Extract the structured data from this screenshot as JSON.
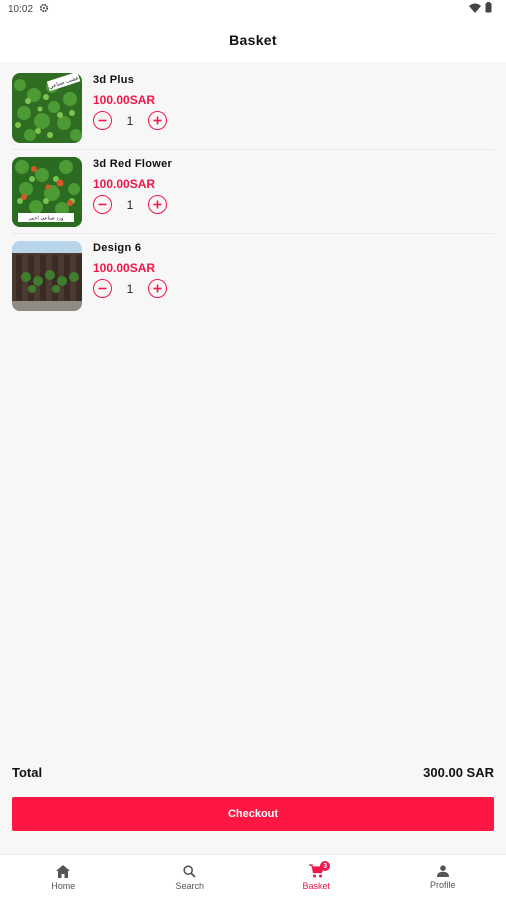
{
  "status_bar": {
    "time": "10:02",
    "icons": [
      "settings-icon",
      "wifi-icon",
      "battery-icon"
    ]
  },
  "header": {
    "title": "Basket"
  },
  "items": [
    {
      "name": "3d Plus",
      "price": "100.00SAR",
      "quantity": "1",
      "thumb_label": "عشب صناعي"
    },
    {
      "name": "3d Red Flower",
      "price": "100.00SAR",
      "quantity": "1",
      "thumb_label": "ورد صناعي احمر"
    },
    {
      "name": "Design 6",
      "price": "100.00SAR",
      "quantity": "1",
      "thumb_label": ""
    }
  ],
  "summary": {
    "total_label": "Total",
    "total_value": "300.00 SAR"
  },
  "checkout_label": "Checkout",
  "nav": {
    "home": "Home",
    "search": "Search",
    "basket": "Basket",
    "profile": "Profile",
    "basket_badge": "3"
  },
  "colors": {
    "accent": "#f0164a",
    "checkout": "#ff1744",
    "background": "#f7f7f7"
  }
}
